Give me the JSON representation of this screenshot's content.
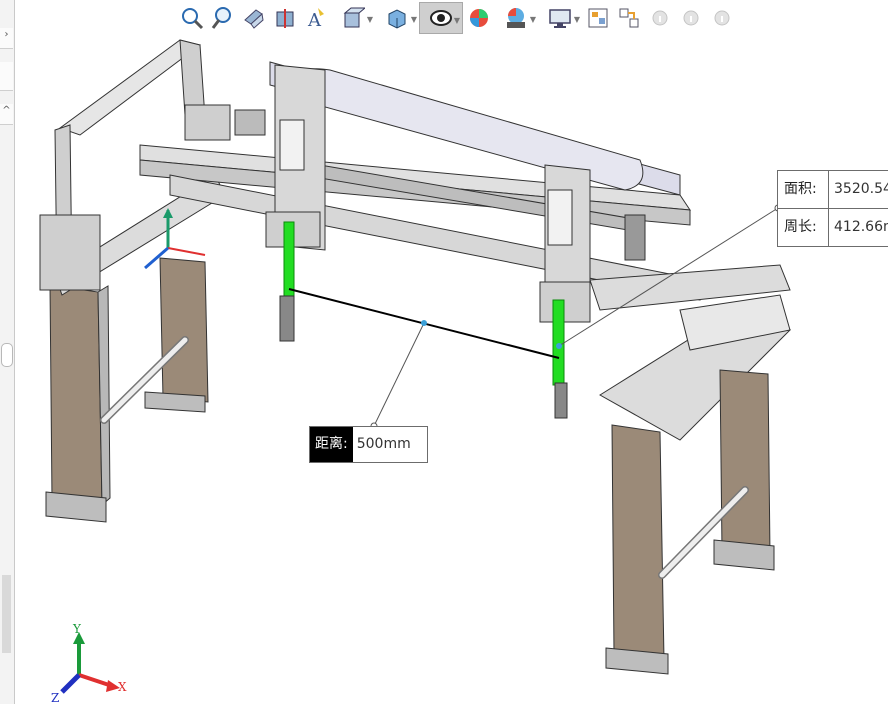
{
  "toolbar": {
    "icons": [
      "zoom-to-fit-icon",
      "zoom-to-area-icon",
      "previous-view-icon",
      "section-view-icon",
      "dynamic-annotation-icon",
      "view-orientation-icon",
      "display-style-icon",
      "hide-show-items-icon",
      "edit-appearance-icon",
      "apply-scene-icon",
      "view-settings-icon",
      "window-tile-icon",
      "rebuild-icon",
      "info-icon",
      "info-icon",
      "info-icon"
    ]
  },
  "measure": {
    "distance_label": "距离:",
    "distance_value": "500mm",
    "area_label": "面积:",
    "area_value": "3520.54",
    "perimeter_label": "周长:",
    "perimeter_value": "412.66m"
  },
  "triad": {
    "x": "X",
    "y": "Y",
    "z": "Z"
  },
  "colors": {
    "highlight_green": "#22dd22",
    "frame_steel": "#cfcfcf",
    "leg_brown": "#9b8a78",
    "accent_blue": "#3aa0d8"
  }
}
